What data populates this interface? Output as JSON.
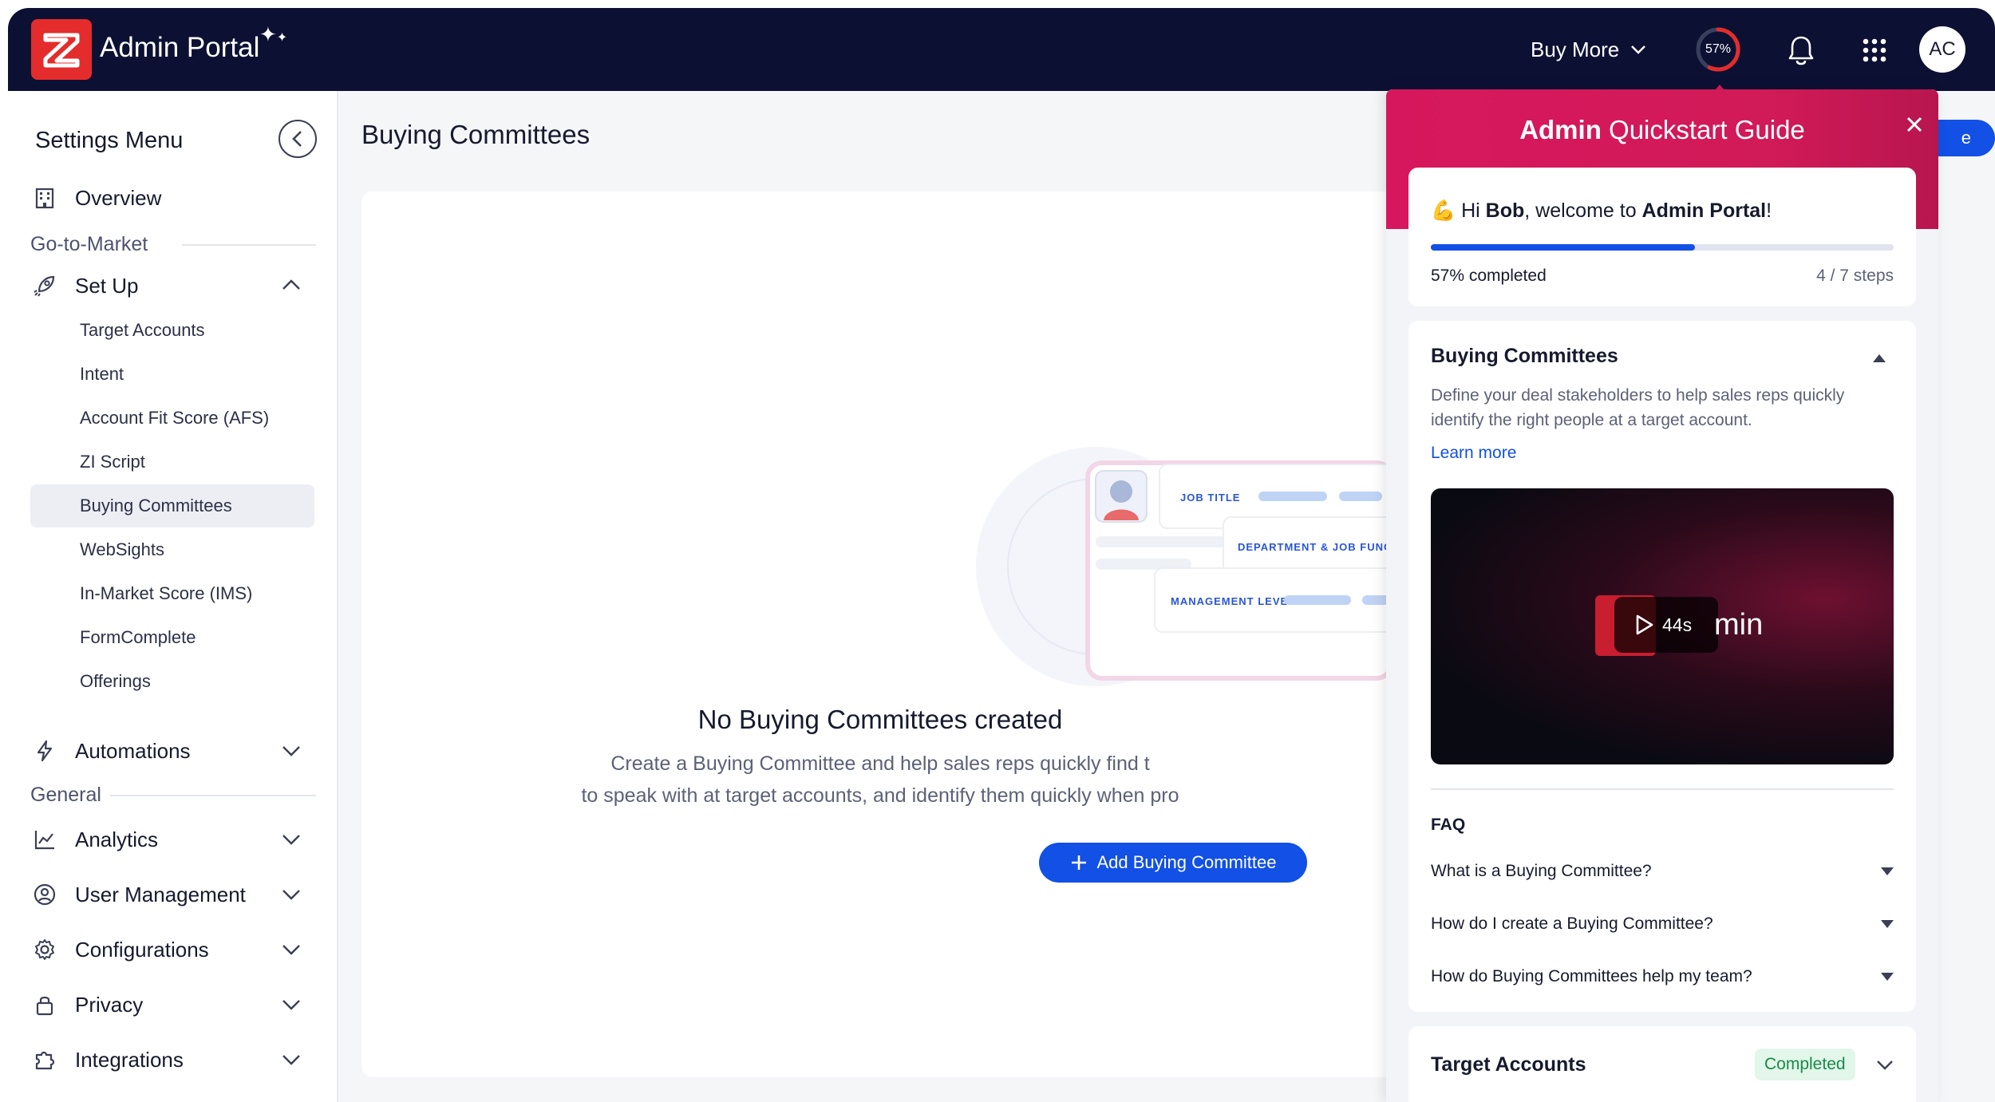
{
  "header": {
    "app_title": "Admin Portal",
    "buy_more": "Buy More",
    "progress_label": "57%",
    "progress_fraction": 0.57,
    "avatar_initials": "AC"
  },
  "sidebar": {
    "title": "Settings Menu",
    "overview": "Overview",
    "group_gtm": "Go-to-Market",
    "setup": "Set Up",
    "setup_items": [
      "Target Accounts",
      "Intent",
      "Account Fit Score (AFS)",
      "ZI Script",
      "Buying Committees",
      "WebSights",
      "In-Market Score (IMS)",
      "FormComplete",
      "Offerings"
    ],
    "automations": "Automations",
    "group_general": "General",
    "general_items": [
      "Analytics",
      "User Management",
      "Configurations",
      "Privacy",
      "Integrations"
    ]
  },
  "main": {
    "page_title": "Buying Committees",
    "header_button": "e",
    "illustration": {
      "job_title": "JOB TITLE",
      "department": "DEPARTMENT & JOB FUNCTION",
      "management": "MANAGEMENT LEVEL"
    },
    "empty_title": "No Buying Committees created",
    "empty_line1": "Create a Buying Committee and help sales reps quickly find t",
    "empty_line2": "to speak with at target accounts, and identify them quickly when pro",
    "add_button": "Add Buying Committee"
  },
  "quickstart": {
    "title_bold": "Admin",
    "title_rest": " Quickstart Guide",
    "welcome_emoji": "💪",
    "welcome_hi": "Hi ",
    "welcome_name": "Bob",
    "welcome_mid": ", welcome to ",
    "welcome_portal": "Admin Portal",
    "welcome_end": "!",
    "completed_label": "57% completed",
    "completed_fraction": 0.57,
    "steps_label": "4 / 7 steps",
    "section_title": "Buying Committees",
    "section_desc": "Define your deal stakeholders to help sales reps quickly identify the right people at a target account.",
    "learn_more": "Learn more",
    "video_duration": "44s",
    "video_text": "min",
    "faq_title": "FAQ",
    "faq_items": [
      "What is a Buying Committee?",
      "How do I create a Buying Committee?",
      "How do Buying Committees help my team?"
    ],
    "next_section": "Target Accounts",
    "next_badge": "Completed"
  },
  "colors": {
    "topbar": "#0c1133",
    "accent_blue": "#1250e6",
    "quickstart_magenta": "#d11a58",
    "logo_red": "#e42c2c",
    "success_green": "#198a4a"
  }
}
